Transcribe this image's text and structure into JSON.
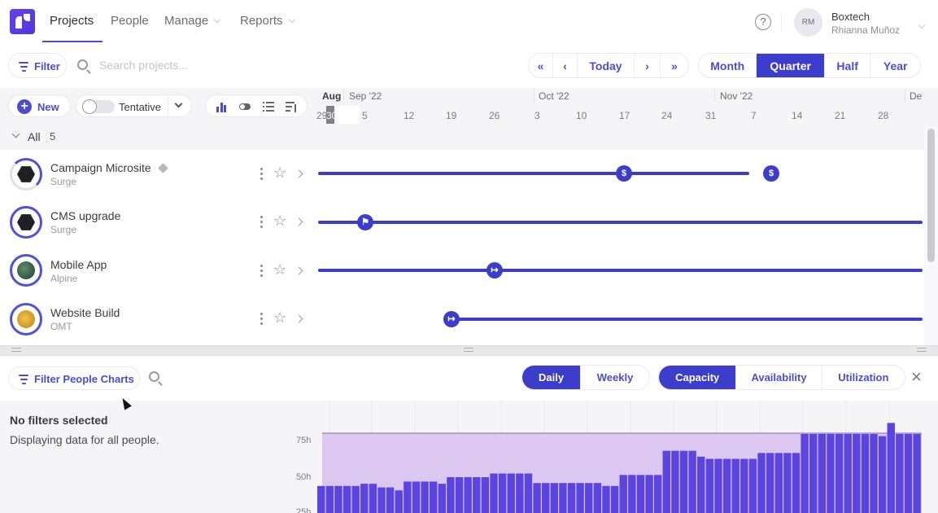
{
  "app": {
    "nav": [
      {
        "label": "Projects",
        "active": true
      },
      {
        "label": "People",
        "active": false
      },
      {
        "label": "Manage",
        "active": false,
        "dropdown": true
      },
      {
        "label": "Reports",
        "active": false,
        "dropdown": true
      }
    ],
    "help_icon": "?",
    "account": {
      "initials": "RM",
      "org": "Boxtech",
      "user": "Rhianna Muñoz"
    }
  },
  "toolbar": {
    "filter_label": "Filter",
    "search_placeholder": "Search projects...",
    "date_nav": {
      "first": "«",
      "prev": "‹",
      "today": "Today",
      "next": "›",
      "last": "»"
    },
    "ranges": [
      {
        "label": "Month",
        "active": false
      },
      {
        "label": "Quarter",
        "active": true
      },
      {
        "label": "Half",
        "active": false
      },
      {
        "label": "Year",
        "active": false
      }
    ]
  },
  "subtoolbar": {
    "new_label": "New",
    "tentative_label": "Tentative",
    "tentative_on": false,
    "view_tools": [
      "bar-chart-icon",
      "toggle-icon",
      "list-icon",
      "sort-icon"
    ]
  },
  "group": {
    "label": "All",
    "count": "5"
  },
  "timeline": {
    "months": [
      {
        "label": "Aug",
        "bold": true
      },
      {
        "label": "Sep '22"
      },
      {
        "label": "Oct '22"
      },
      {
        "label": "Nov '22"
      },
      {
        "label": "De"
      }
    ],
    "days": [
      "29",
      "30",
      "5",
      "12",
      "19",
      "26",
      "3",
      "10",
      "17",
      "24",
      "31",
      "7",
      "14",
      "21",
      "28"
    ]
  },
  "projects": [
    {
      "name": "Campaign Microsite",
      "client": "Surge",
      "has_tag": true,
      "milestones": [
        "$",
        "$"
      ]
    },
    {
      "name": "CMS upgrade",
      "client": "Surge",
      "has_tag": false,
      "milestones": [
        "flag"
      ]
    },
    {
      "name": "Mobile App",
      "client": "Alpine",
      "has_tag": false,
      "milestones": [
        "start"
      ]
    },
    {
      "name": "Website Build",
      "client": "OMT",
      "has_tag": false,
      "milestones": [
        "start"
      ]
    }
  ],
  "people_panel": {
    "filter_label": "Filter People Charts",
    "intervals": [
      {
        "label": "Daily",
        "active": true
      },
      {
        "label": "Weekly",
        "active": false
      }
    ],
    "metrics": [
      {
        "label": "Capacity",
        "active": true
      },
      {
        "label": "Availability",
        "active": false
      },
      {
        "label": "Utilization",
        "active": false
      }
    ],
    "close_icon": "×",
    "no_filters_title": "No filters selected",
    "no_filters_sub": "Displaying data for all people."
  },
  "chart_data": {
    "type": "bar",
    "title": "",
    "ylabel": "",
    "xlabel": "",
    "y_ticks": [
      "75h",
      "50h",
      "25h"
    ],
    "ylim": [
      25,
      90
    ],
    "capacity_line": 80,
    "capacity_color": "#dcc7f0",
    "bar_color": "#5b45e0",
    "values": [
      44,
      44,
      44,
      44,
      44,
      45.5,
      45.5,
      43,
      43,
      41,
      47,
      47,
      47,
      47,
      45.5,
      50,
      50,
      50,
      50,
      50,
      52.5,
      52.5,
      52.5,
      52.5,
      52.5,
      46,
      46,
      46,
      46,
      46,
      46,
      46,
      46,
      44,
      44,
      51.5,
      51.5,
      51.5,
      51.5,
      51.5,
      68,
      68,
      68,
      68,
      64,
      62.5,
      62.5,
      62.5,
      62.5,
      62.5,
      62.5,
      66.5,
      66.5,
      66.5,
      66.5,
      66.5,
      79.5,
      79.5,
      79.5,
      79.5,
      79.5,
      79.5,
      79.5,
      79.5,
      79.5,
      78,
      87,
      79.5,
      79.5,
      79.5
    ]
  }
}
